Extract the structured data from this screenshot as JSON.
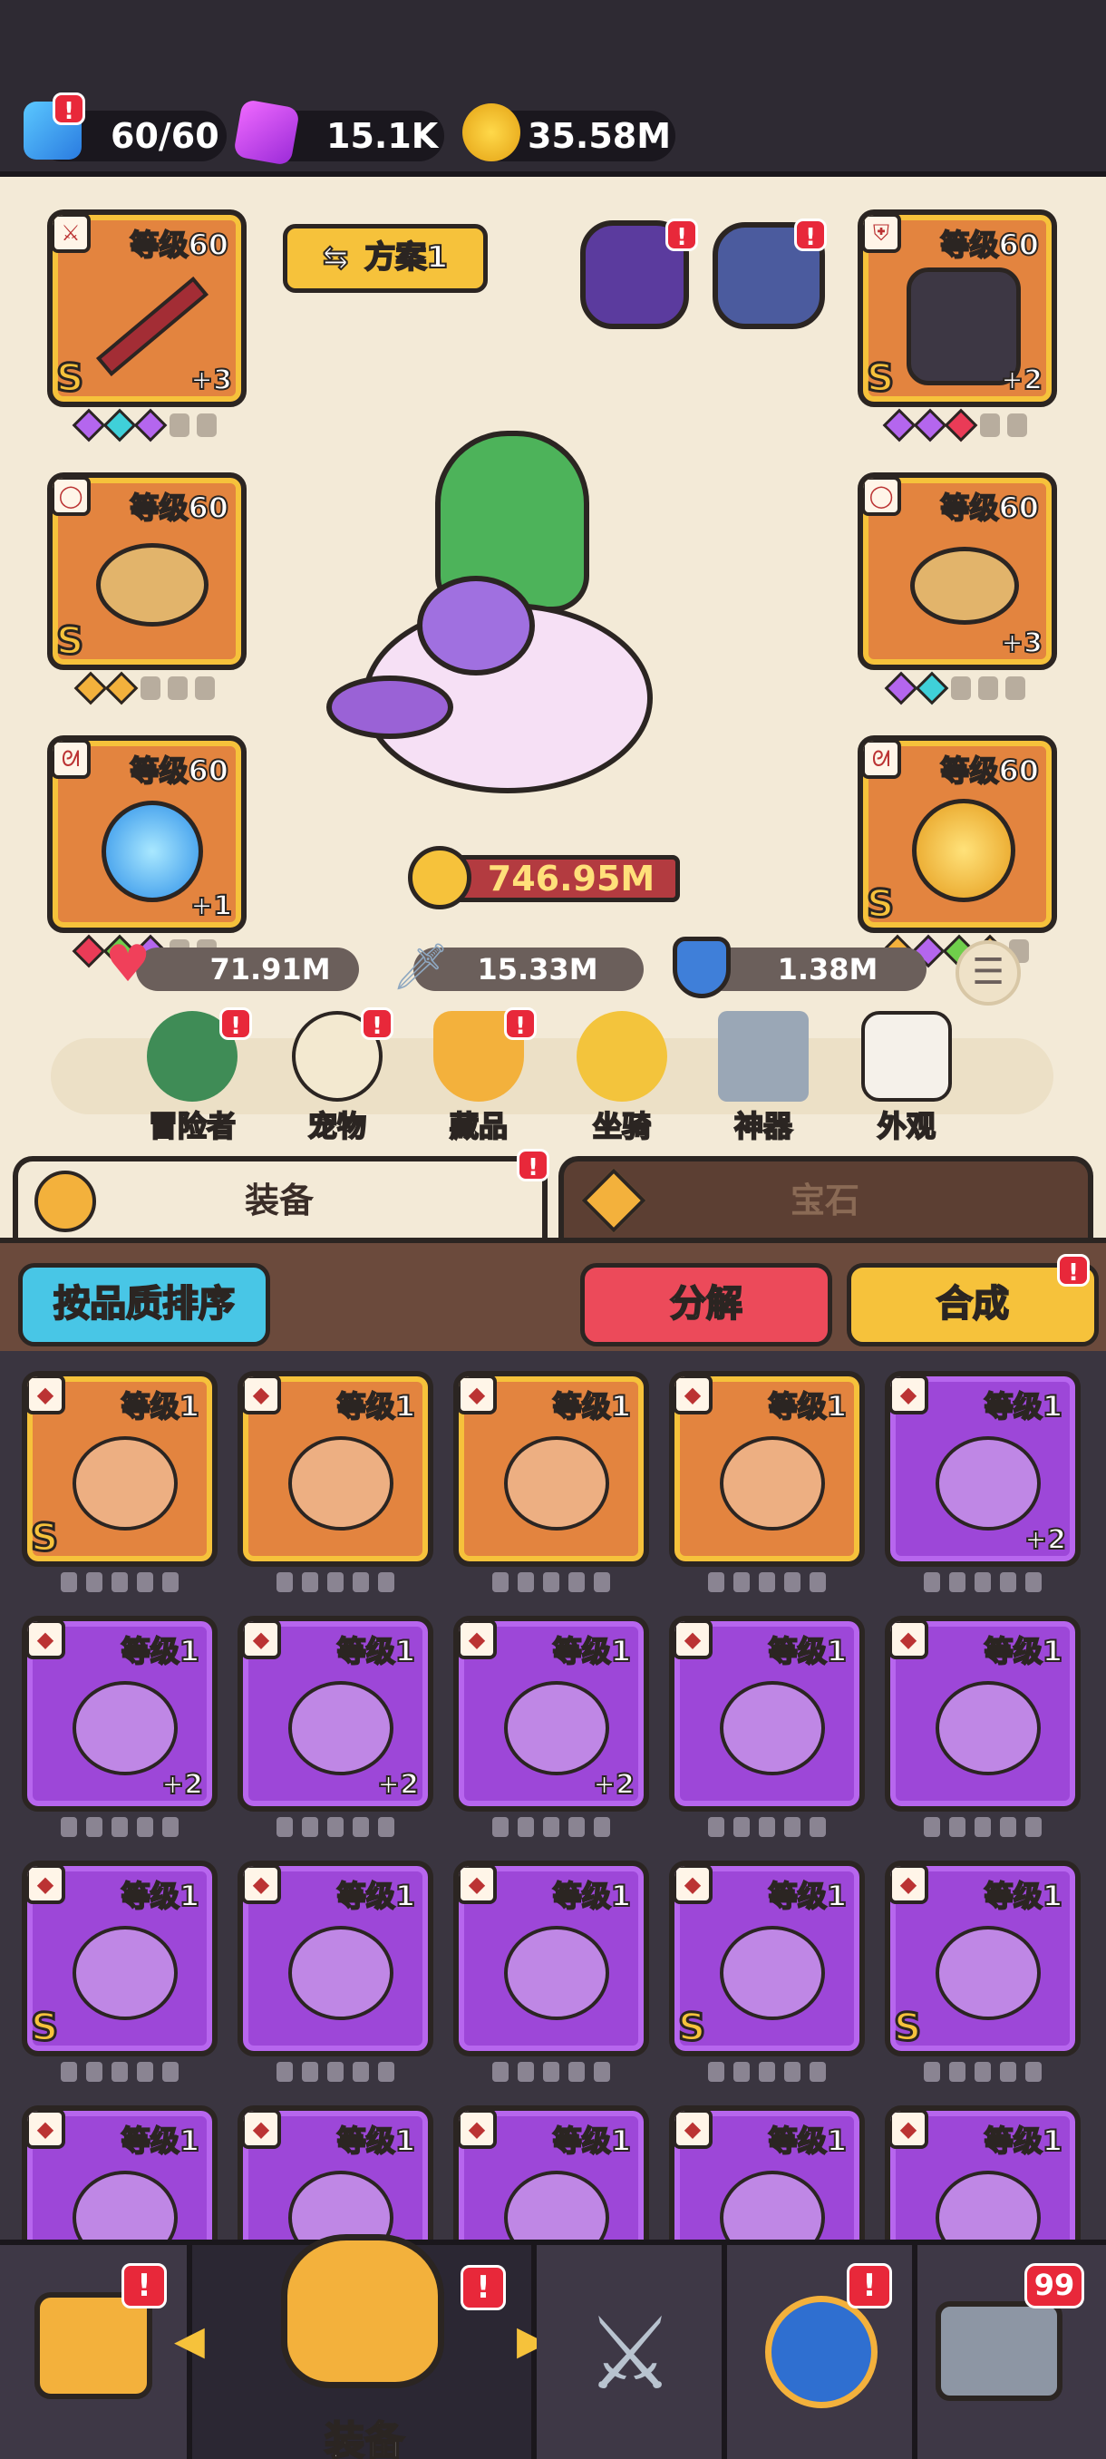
{
  "resources": {
    "energy": "60/60",
    "gems": "15.1K",
    "gold": "35.58M"
  },
  "loadout": {
    "plan_label": "方案1"
  },
  "equipped_left": [
    {
      "level": "等级60",
      "plus": "+3",
      "rank": "S",
      "icon": "sword-icon"
    },
    {
      "level": "等级60",
      "plus": "",
      "rank": "S",
      "icon": "ring-icon"
    },
    {
      "level": "等级60",
      "plus": "+1",
      "rank": "",
      "icon": "amulet-icon"
    }
  ],
  "equipped_right": [
    {
      "level": "等级60",
      "plus": "+2",
      "rank": "S",
      "icon": "armor-icon"
    },
    {
      "level": "等级60",
      "plus": "+3",
      "rank": "",
      "icon": "ring-icon"
    },
    {
      "level": "等级60",
      "plus": "",
      "rank": "S",
      "icon": "medal-icon"
    }
  ],
  "power": "746.95M",
  "stats": {
    "hp": "71.91M",
    "attack": "15.33M",
    "defense": "1.38M"
  },
  "features": [
    {
      "label": "冒险者",
      "icon": "adventurer-icon",
      "alert": "!"
    },
    {
      "label": "宠物",
      "icon": "pet-egg-icon",
      "alert": "!"
    },
    {
      "label": "藏品",
      "icon": "collection-icon",
      "alert": "!"
    },
    {
      "label": "坐骑",
      "icon": "horseshoe-icon",
      "alert": ""
    },
    {
      "label": "神器",
      "icon": "hammer-icon",
      "alert": ""
    },
    {
      "label": "外观",
      "icon": "outfit-icon",
      "alert": ""
    }
  ],
  "tabs": {
    "equipment": "装备",
    "gems": "宝石"
  },
  "actions": {
    "sort": "按品质排序",
    "decompose": "分解",
    "merge": "合成"
  },
  "inventory": [
    {
      "level": "等级1",
      "plus": "",
      "rank": "S",
      "color": "gold"
    },
    {
      "level": "等级1",
      "plus": "",
      "rank": "",
      "color": "gold"
    },
    {
      "level": "等级1",
      "plus": "",
      "rank": "",
      "color": "gold"
    },
    {
      "level": "等级1",
      "plus": "",
      "rank": "",
      "color": "gold"
    },
    {
      "level": "等级1",
      "plus": "+2",
      "rank": "",
      "color": "purple"
    },
    {
      "level": "等级1",
      "plus": "+2",
      "rank": "",
      "color": "purple"
    },
    {
      "level": "等级1",
      "plus": "+2",
      "rank": "",
      "color": "purple"
    },
    {
      "level": "等级1",
      "plus": "+2",
      "rank": "",
      "color": "purple"
    },
    {
      "level": "等级1",
      "plus": "",
      "rank": "",
      "color": "purple"
    },
    {
      "level": "等级1",
      "plus": "",
      "rank": "",
      "color": "purple"
    },
    {
      "level": "等级1",
      "plus": "",
      "rank": "S",
      "color": "purple"
    },
    {
      "level": "等级1",
      "plus": "",
      "rank": "",
      "color": "purple"
    },
    {
      "level": "等级1",
      "plus": "",
      "rank": "",
      "color": "purple"
    },
    {
      "level": "等级1",
      "plus": "",
      "rank": "S",
      "color": "purple"
    },
    {
      "level": "等级1",
      "plus": "",
      "rank": "S",
      "color": "purple"
    },
    {
      "level": "等级1",
      "plus": "",
      "rank": "",
      "color": "purple"
    },
    {
      "level": "等级1",
      "plus": "",
      "rank": "",
      "color": "purple"
    },
    {
      "level": "等级1",
      "plus": "",
      "rank": "",
      "color": "purple"
    },
    {
      "level": "等级1",
      "plus": "",
      "rank": "",
      "color": "purple"
    },
    {
      "level": "等级1",
      "plus": "",
      "rank": "",
      "color": "purple"
    }
  ],
  "bottom_nav": {
    "active_label": "装备",
    "chest_count": "99"
  }
}
